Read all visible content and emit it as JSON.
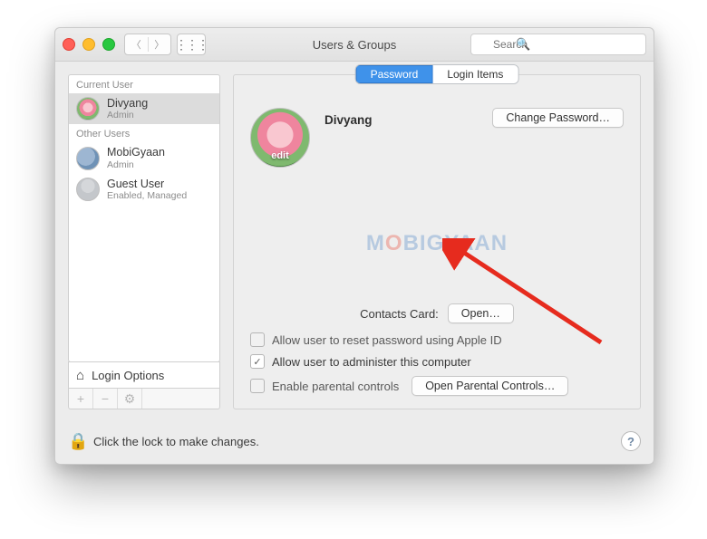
{
  "window_title": "Users & Groups",
  "search": {
    "placeholder": "Search"
  },
  "sidebar": {
    "header_current": "Current User",
    "header_other": "Other Users",
    "current": {
      "name": "Divyang",
      "role": "Admin"
    },
    "others": [
      {
        "name": "MobiGyaan",
        "role": "Admin"
      },
      {
        "name": "Guest User",
        "role": "Enabled, Managed"
      }
    ],
    "login_options_label": "Login Options"
  },
  "tabs": {
    "password": "Password",
    "login_items": "Login Items"
  },
  "main": {
    "user_name": "Divyang",
    "avatar_edit_label": "edit",
    "change_password_btn": "Change Password…",
    "contacts_label": "Contacts Card:",
    "contacts_open_btn": "Open…",
    "check_reset_appleid": "Allow user to reset password using Apple ID",
    "check_admin": "Allow user to administer this computer",
    "check_parental": "Enable parental controls",
    "open_parental_btn": "Open Parental Controls…"
  },
  "footer": {
    "text": "Click the lock to make changes."
  },
  "watermark": {
    "pre": "M",
    "oo": "O",
    "rest": "BIGYAAN"
  }
}
